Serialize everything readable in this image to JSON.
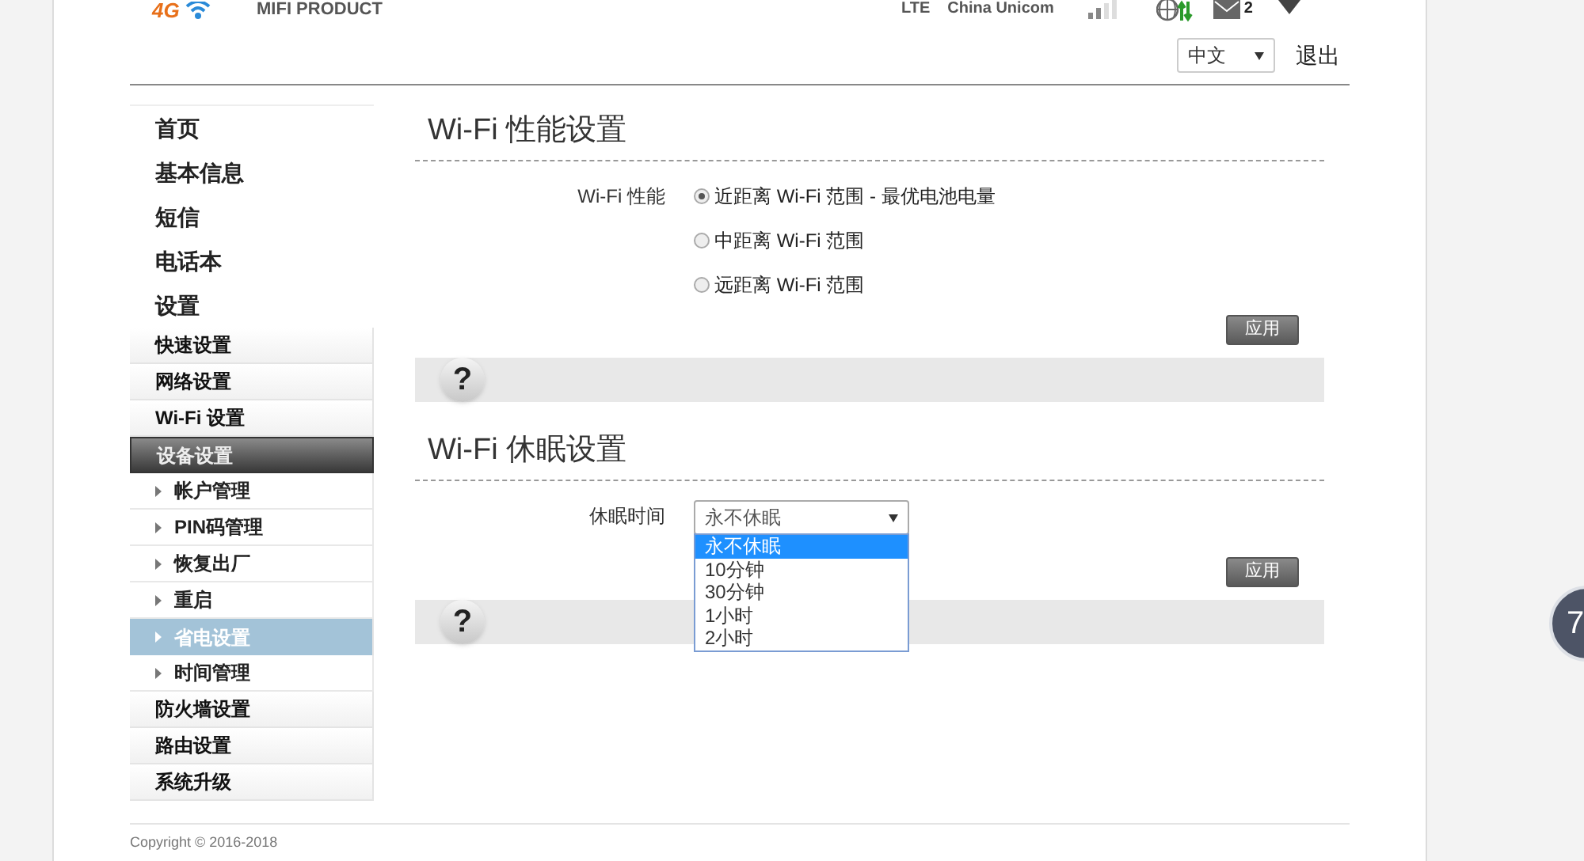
{
  "header": {
    "logo_badge": "4G",
    "product": "MIFI PRODUCT",
    "network": "LTE",
    "carrier": "China Unicom",
    "message_count": "2",
    "language": "中文",
    "logout": "退出"
  },
  "nav": [
    {
      "label": "首页"
    },
    {
      "label": "基本信息"
    },
    {
      "label": "短信"
    },
    {
      "label": "电话本"
    },
    {
      "label": "设置"
    }
  ],
  "settings_menu": [
    {
      "label": "快速设置",
      "selected": false
    },
    {
      "label": "网络设置",
      "selected": false
    },
    {
      "label": "Wi-Fi 设置",
      "selected": false
    },
    {
      "label": "设备设置",
      "selected": true,
      "children": [
        {
          "label": "帐户管理",
          "selected": false
        },
        {
          "label": "PIN码管理",
          "selected": false
        },
        {
          "label": "恢复出厂",
          "selected": false
        },
        {
          "label": "重启",
          "selected": false
        },
        {
          "label": "省电设置",
          "selected": true
        },
        {
          "label": "时间管理",
          "selected": false
        }
      ]
    },
    {
      "label": "防火墙设置",
      "selected": false
    },
    {
      "label": "路由设置",
      "selected": false
    },
    {
      "label": "系统升级",
      "selected": false
    }
  ],
  "performance": {
    "title": "Wi-Fi 性能设置",
    "field_label": "Wi-Fi 性能",
    "options": [
      {
        "label": "近距离 Wi-Fi 范围 - 最优电池电量",
        "selected": true
      },
      {
        "label": "中距离 Wi-Fi 范围",
        "selected": false
      },
      {
        "label": "远距离 Wi-Fi 范围",
        "selected": false
      }
    ],
    "apply": "应用",
    "help": "?"
  },
  "sleep": {
    "title": "Wi-Fi 休眠设置",
    "field_label": "休眠时间",
    "value": "永不休眠",
    "options": [
      {
        "label": "永不休眠",
        "selected": true
      },
      {
        "label": "10分钟",
        "selected": false
      },
      {
        "label": "30分钟",
        "selected": false
      },
      {
        "label": "1小时",
        "selected": false
      },
      {
        "label": "2小时",
        "selected": false
      }
    ],
    "apply": "应用",
    "help": "?"
  },
  "floating_widget": {
    "label": "7"
  },
  "footer": {
    "copyright": "Copyright © 2016-2018"
  }
}
